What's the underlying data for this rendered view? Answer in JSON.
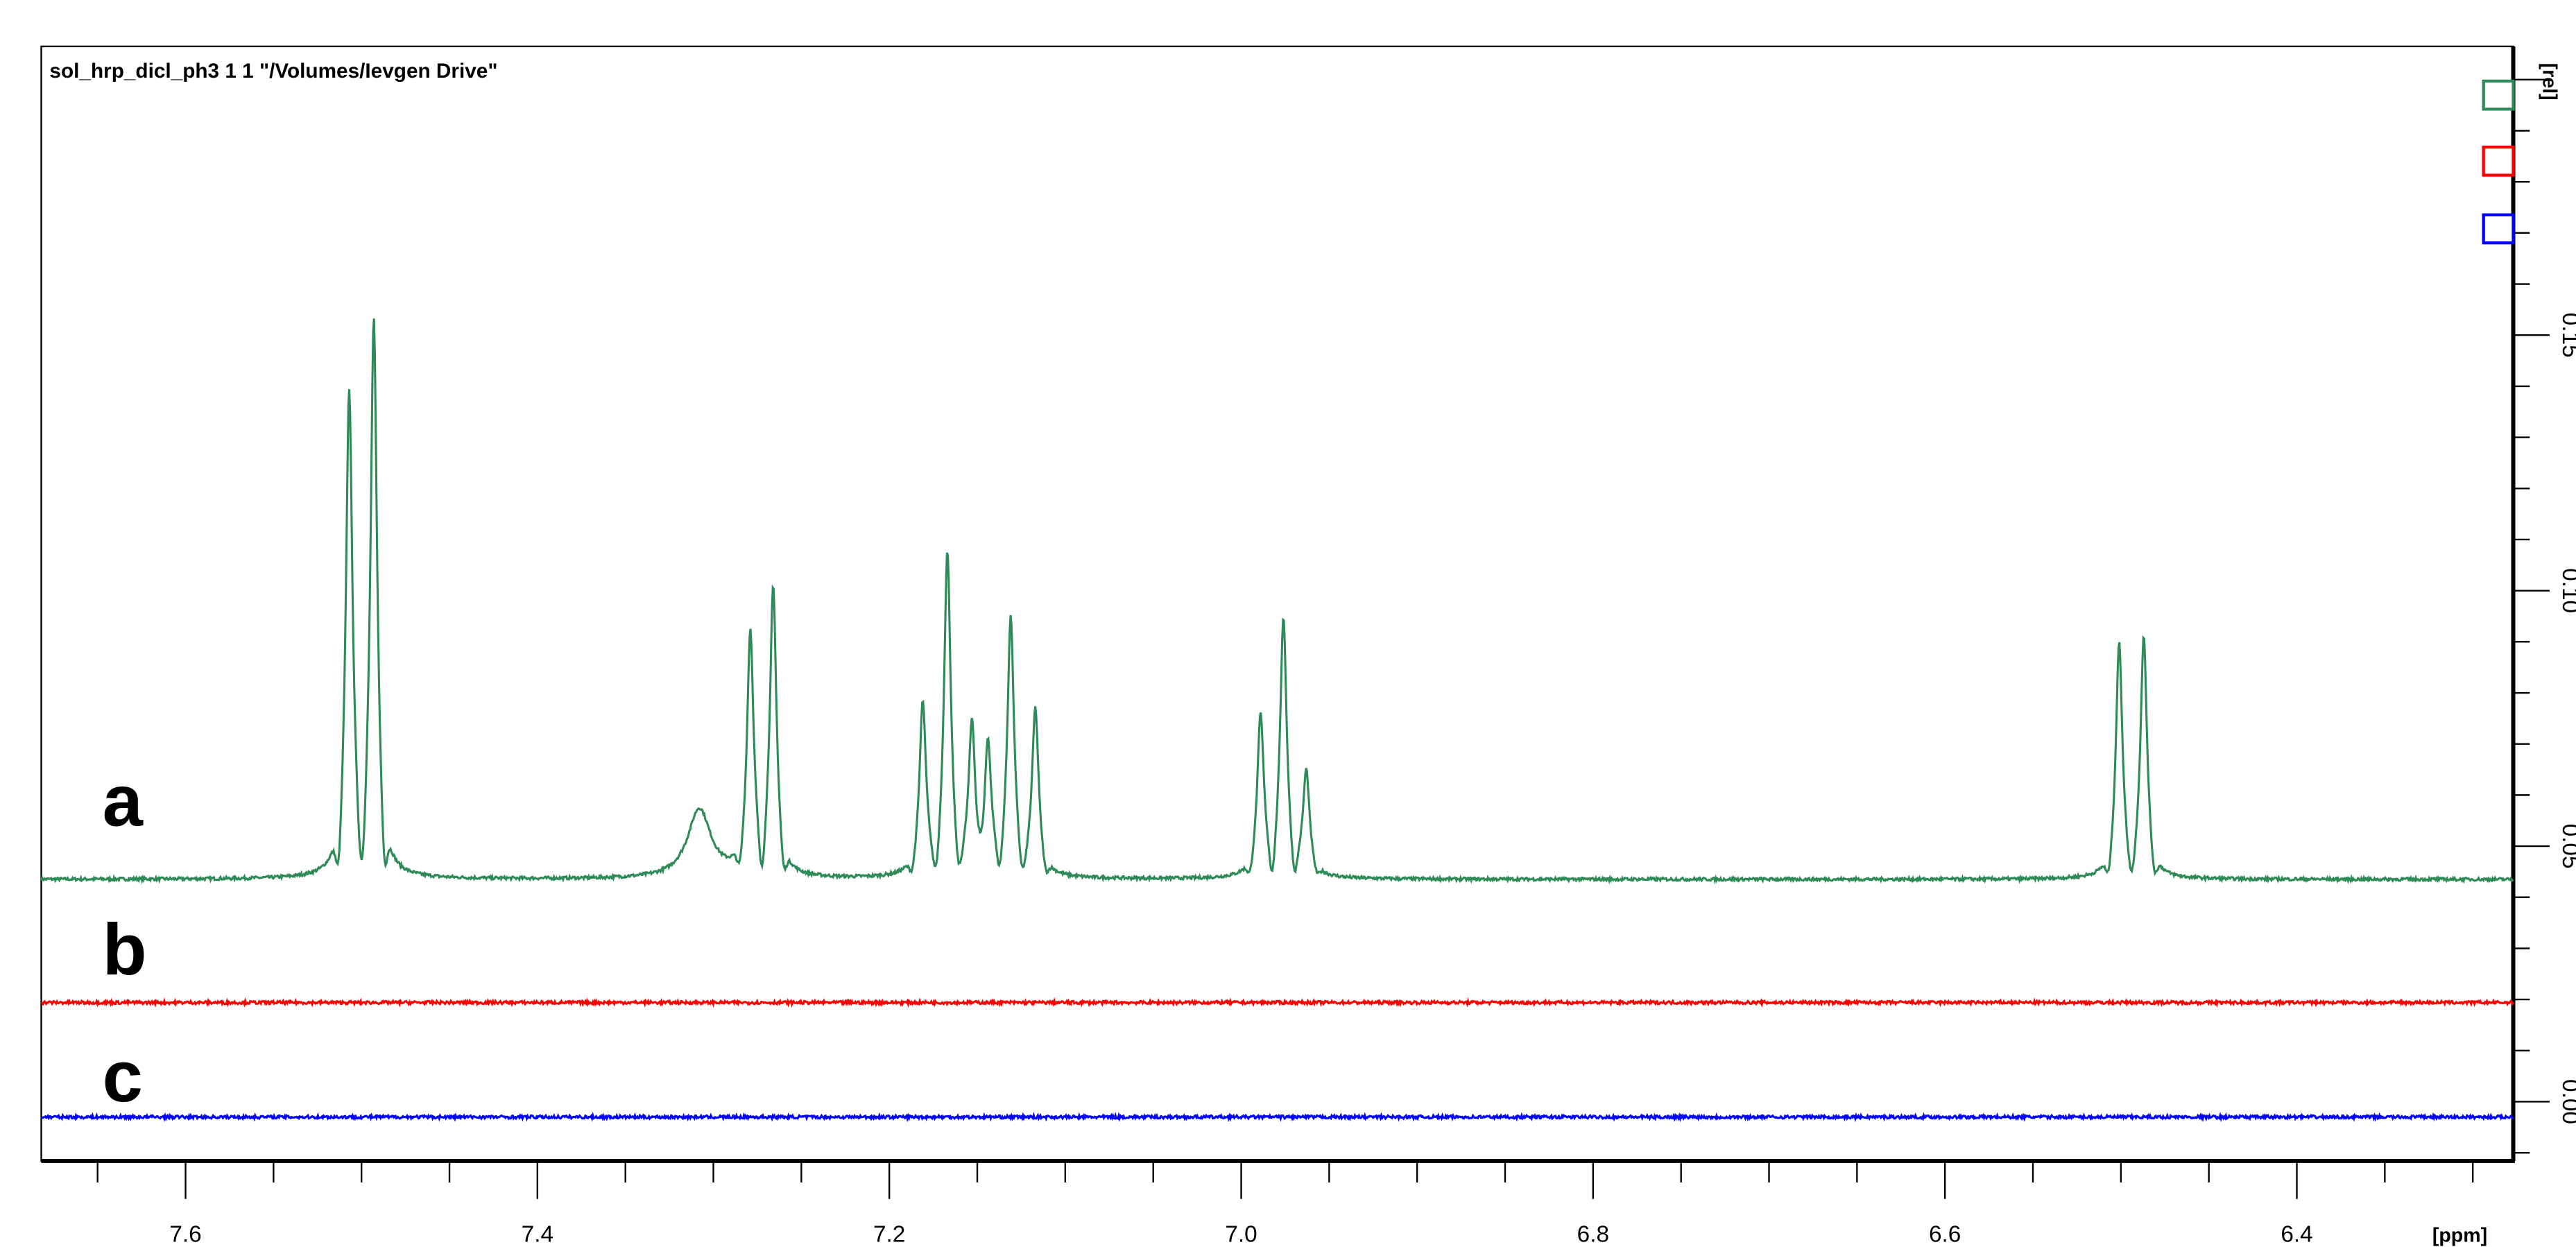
{
  "chart_data": {
    "type": "line",
    "title": "sol_hrp_dicl_ph3  1  1  \"/Volumes/Ievgen Drive\"",
    "xlabel": "[ppm]",
    "ylabel": "[rel]",
    "xlim": [
      7.682,
      6.277
    ],
    "ylim": [
      -0.0116,
      0.2065
    ],
    "x_ticks": [
      "7.6",
      "7.4",
      "7.2",
      "7.0",
      "6.8",
      "6.6",
      "6.4"
    ],
    "x_tick_values": [
      7.6,
      7.4,
      7.2,
      7.0,
      6.8,
      6.6,
      6.4
    ],
    "y_ticks": [
      "0.00",
      "0.05",
      "0.10",
      "0.15"
    ],
    "y_tick_values": [
      0.0,
      0.05,
      0.1,
      0.15
    ],
    "grid": false,
    "legend": "top-right",
    "series": [
      {
        "name": "a",
        "color": "#2e8b57",
        "baseline": 0.0435,
        "peaks": [
          {
            "ppm": 7.507,
            "height": 0.137
          },
          {
            "ppm": 7.493,
            "height": 0.151
          },
          {
            "ppm": 7.308,
            "height": 0.057,
            "broad": true
          },
          {
            "ppm": 7.279,
            "height": 0.09
          },
          {
            "ppm": 7.266,
            "height": 0.099
          },
          {
            "ppm": 7.181,
            "height": 0.0765
          },
          {
            "ppm": 7.167,
            "height": 0.106
          },
          {
            "ppm": 7.153,
            "height": 0.0716
          },
          {
            "ppm": 7.144,
            "height": 0.0677
          },
          {
            "ppm": 7.131,
            "height": 0.093
          },
          {
            "ppm": 7.117,
            "height": 0.0755
          },
          {
            "ppm": 6.989,
            "height": 0.0745
          },
          {
            "ppm": 6.976,
            "height": 0.0935
          },
          {
            "ppm": 6.963,
            "height": 0.0635
          },
          {
            "ppm": 6.501,
            "height": 0.0887
          },
          {
            "ppm": 6.487,
            "height": 0.09
          }
        ]
      },
      {
        "name": "b",
        "color": "#ff0000",
        "baseline": 0.0194,
        "peaks": []
      },
      {
        "name": "c",
        "color": "#0000ff",
        "baseline": -0.003,
        "peaks": []
      }
    ]
  }
}
